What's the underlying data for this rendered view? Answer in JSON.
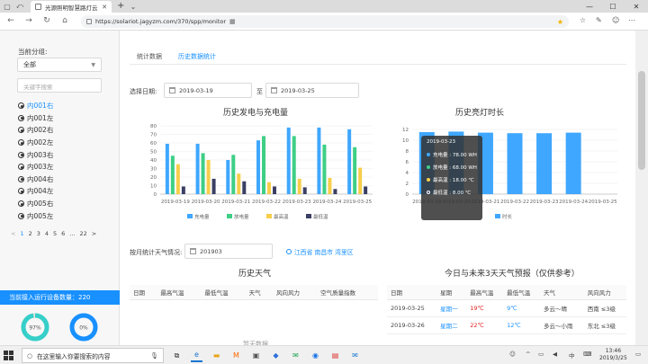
{
  "browser": {
    "tab_title": "光源照明智慧路灯云",
    "url": "https://solariot.jagyzm.com/370/spp/monitor"
  },
  "sidebar": {
    "group_label": "当前分组:",
    "group_value": "全部",
    "search_placeholder": "关键字搜索",
    "devices": [
      "内001右",
      "内001左",
      "内002右",
      "内002左",
      "内003右",
      "内003左",
      "内004右",
      "内004左",
      "内005右",
      "内005左"
    ],
    "pager": [
      "<",
      "1",
      "2",
      "3",
      "4",
      "5",
      "6",
      "...",
      "22",
      ">"
    ],
    "online_text": "当前接入运行设备数量：",
    "online_count": "220",
    "donuts": [
      {
        "label": "97%",
        "value": 0.97,
        "color": "#36cfc9"
      },
      {
        "label": "0%",
        "value": 0.0,
        "color": "#1890ff"
      }
    ]
  },
  "main": {
    "tabs": [
      "统计数据",
      "历史数据统计"
    ],
    "date_label": "选择日期:",
    "date_from": "2019-03-19",
    "date_sep": "至",
    "date_to": "2019-03-25",
    "weather_label": "按月统计天气情况:",
    "weather_month": "201903",
    "location": "江西省 南昌市 湾里区",
    "history_weather_title": "历史天气",
    "history_weather_headers": [
      "日期",
      "最高气温",
      "最低气温",
      "天气",
      "风向风力",
      "空气质量指数"
    ],
    "no_data": "暂无数据",
    "forecast_title": "今日与未来3天天气预报（仅供参考）",
    "forecast_headers": [
      "日期",
      "星期",
      "最高气温",
      "最低气温",
      "天气",
      "风向风力"
    ],
    "forecast_rows": [
      {
        "date": "2019-03-25",
        "week": "星期一",
        "high": "19℃",
        "low": "9℃",
        "weather": "多云～晴",
        "wind": "西南 ≤3级"
      },
      {
        "date": "2019-03-26",
        "week": "星期二",
        "high": "22℃",
        "low": "12℃",
        "weather": "多云～小雨",
        "wind": "东北 ≤3级"
      }
    ]
  },
  "chart_data": [
    {
      "type": "bar",
      "title": "历史发电与充电量",
      "categories": [
        "2019-03-19",
        "2019-03-20",
        "2019-03-21",
        "2019-03-22",
        "2019-03-23",
        "2019-03-24",
        "2019-03-25"
      ],
      "ylim": [
        0,
        80
      ],
      "yticks": [
        0,
        10,
        20,
        30,
        40,
        50,
        60,
        70,
        80
      ],
      "series": [
        {
          "name": "充电量",
          "color": "#3fa7ff",
          "values": [
            59,
            59,
            40,
            63,
            78,
            78,
            76
          ]
        },
        {
          "name": "放电量",
          "color": "#3ecf86",
          "values": [
            45,
            48,
            46,
            68,
            68,
            58,
            55
          ]
        },
        {
          "name": "最高温",
          "color": "#f7ce4a",
          "values": [
            35,
            40,
            24,
            14,
            18,
            19,
            31
          ]
        },
        {
          "name": "最低温",
          "color": "#3b3f63",
          "values": [
            9,
            18,
            15,
            9,
            8,
            6,
            9
          ]
        }
      ],
      "tooltip": {
        "date": "2019-03-23",
        "rows": [
          "充电量 : 78.00 WH",
          "放电量 : 68.00 WH",
          "最高温 : 18.00 ℃",
          "最低温 : 8.00 ℃"
        ]
      }
    },
    {
      "type": "bar",
      "title": "历史亮灯时长",
      "categories": [
        "2019-03-19",
        "2019-03-20",
        "2019-03-21",
        "2019-03-22",
        "2019-03-23",
        "2019-03-24",
        "2019-03-25"
      ],
      "ylim": [
        0,
        12
      ],
      "yticks": [
        0,
        2,
        4,
        6,
        8,
        10,
        12
      ],
      "series": [
        {
          "name": "时长",
          "color": "#3fa7ff",
          "values": [
            11.5,
            11.6,
            11.4,
            11.3,
            11.3,
            11.4,
            0
          ]
        }
      ]
    }
  ],
  "taskbar": {
    "search_text": "在这里输入你要搜索的内容",
    "ime": "中",
    "time": "13:46",
    "date": "2019/3/25"
  }
}
